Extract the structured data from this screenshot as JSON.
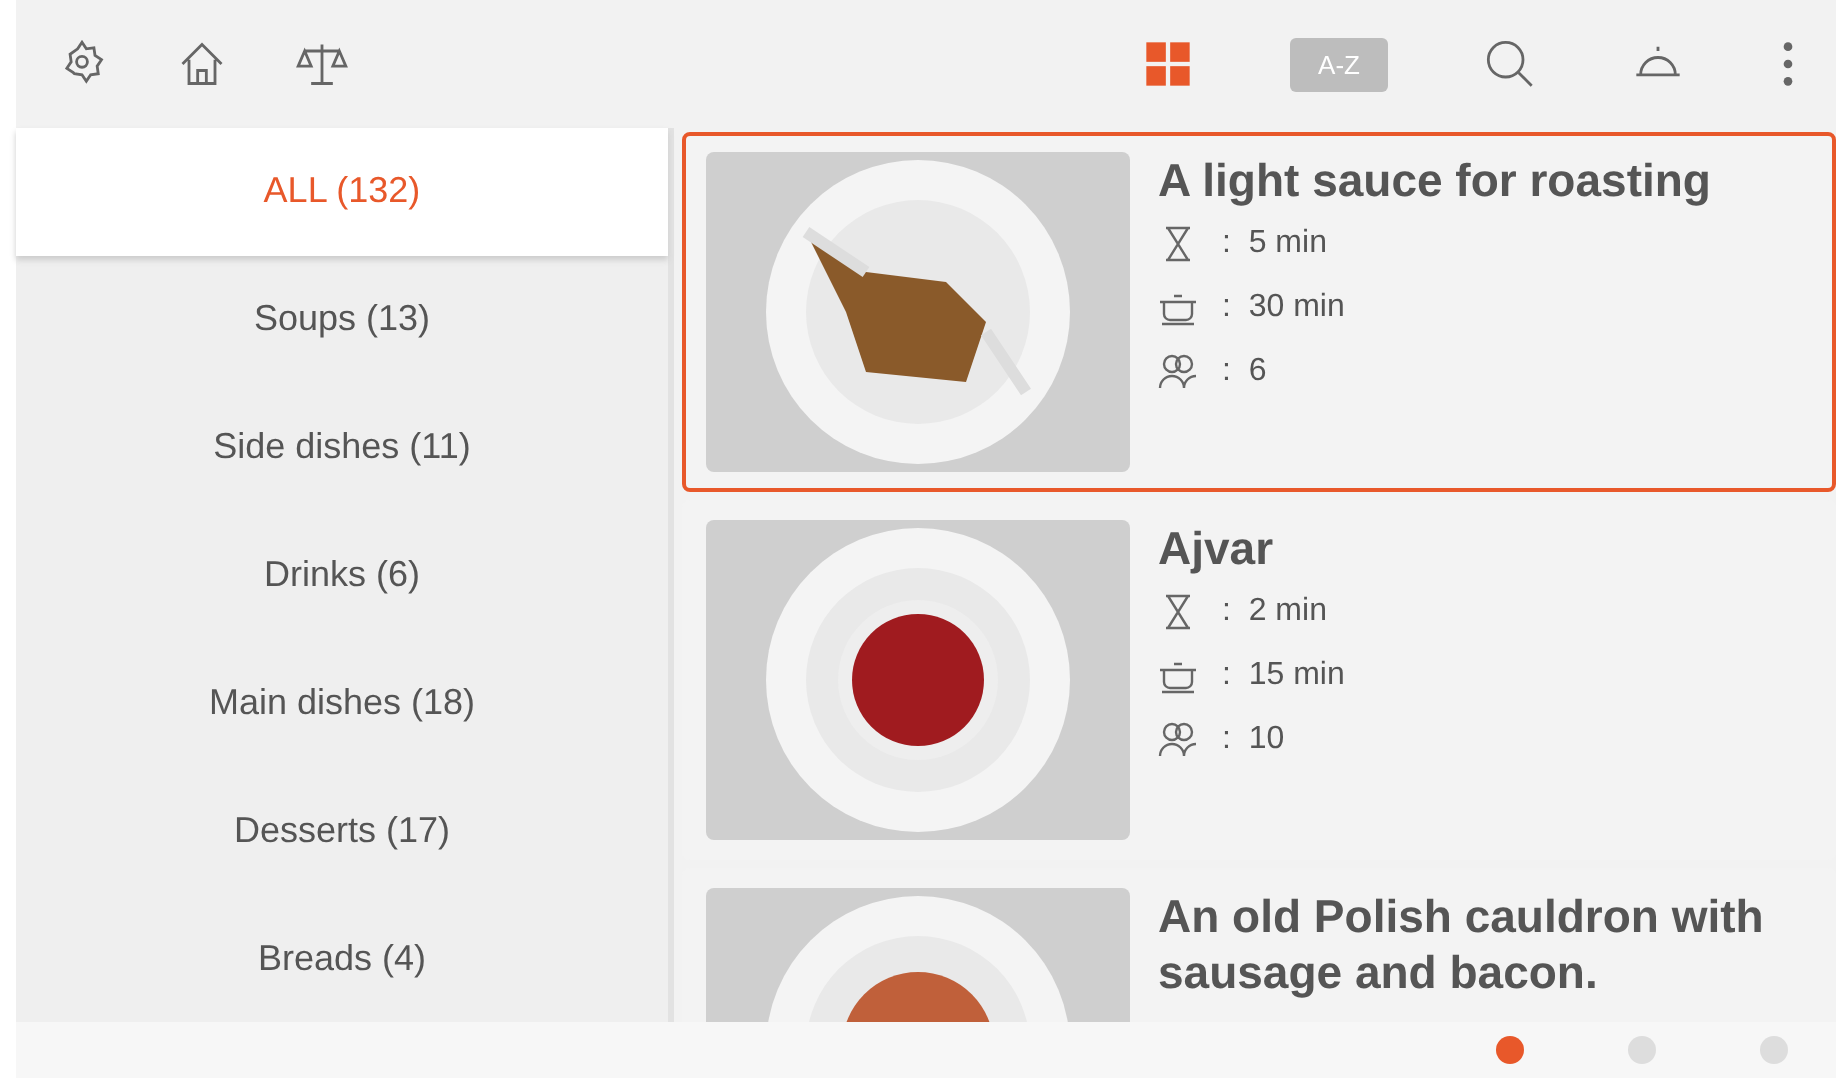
{
  "toolbar": {
    "sort_button": "A-Z",
    "grid_view_selected": true
  },
  "categories": [
    {
      "label": "ALL (132)",
      "selected": true
    },
    {
      "label": "Soups (13)",
      "selected": false
    },
    {
      "label": "Side dishes (11)",
      "selected": false
    },
    {
      "label": "Drinks (6)",
      "selected": false
    },
    {
      "label": "Main dishes (18)",
      "selected": false
    },
    {
      "label": "Desserts  (17)",
      "selected": false
    },
    {
      "label": "Breads  (4)",
      "selected": false
    }
  ],
  "recipes": [
    {
      "title": "A light sauce for roasting",
      "prep_time": ":  5 min",
      "cook_time": ":  30 min",
      "servings": ":  6",
      "selected": true,
      "kind": "sauce"
    },
    {
      "title": "Ajvar",
      "prep_time": ":  2 min",
      "cook_time": ":  15 min",
      "servings": ":  10",
      "selected": false,
      "kind": "bowl"
    },
    {
      "title": "An old Polish cauldron with sausage and bacon.",
      "selected": false,
      "kind": "stew"
    }
  ],
  "pages": [
    {
      "selected": true
    },
    {
      "selected": false
    },
    {
      "selected": false
    }
  ]
}
